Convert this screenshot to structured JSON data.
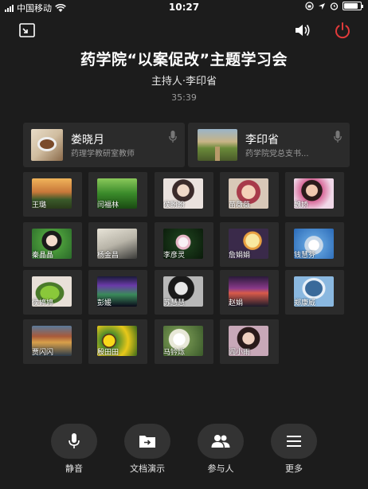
{
  "status_bar": {
    "carrier": "中国移动",
    "time": "10:27",
    "battery_level": 0.85
  },
  "meeting": {
    "title": "药学院“以案促改”主题学习会",
    "host": "主持人·李印省",
    "elapsed": "35:39"
  },
  "speakers": [
    {
      "name": "娄晓月",
      "role": "药理学教研室教师",
      "photo": "food-bowl"
    },
    {
      "name": "李印省",
      "role": "药学院党总支书...",
      "photo": "field-road"
    }
  ],
  "participants": [
    {
      "name": "王璐",
      "photo": "sunset-hill"
    },
    {
      "name": "闫福林",
      "photo": "green-forest"
    },
    {
      "name": "侯盼盼",
      "photo": "portrait-selfie"
    },
    {
      "name": "苗薇薇",
      "photo": "child-portrait"
    },
    {
      "name": "魏娇",
      "photo": "flower-girl"
    },
    {
      "name": "秦晶晶",
      "photo": "woman-garden"
    },
    {
      "name": "杨金昌",
      "photo": "crane-bird"
    },
    {
      "name": "李彦灵",
      "photo": "water-lily"
    },
    {
      "name": "詹娟娟",
      "photo": "moon-cartoon"
    },
    {
      "name": "钱慧芬",
      "photo": "white-ornament"
    },
    {
      "name": "侯婷婷",
      "photo": "green-leaf"
    },
    {
      "name": "彭媛",
      "photo": "night-lights"
    },
    {
      "name": "苏慧慧",
      "photo": "bw-portrait"
    },
    {
      "name": "赵娟",
      "photo": "city-night"
    },
    {
      "name": "郑康威",
      "photo": "parasol-sky"
    },
    {
      "name": "贾闪闪",
      "photo": "autumn-lake"
    },
    {
      "name": "殷田田",
      "photo": "sunflowers"
    },
    {
      "name": "马钤烁",
      "photo": "white-flowers"
    },
    {
      "name": "阎小雨",
      "photo": "girl-portrait"
    }
  ],
  "toolbar": [
    {
      "label": "静音",
      "icon": "microphone-icon"
    },
    {
      "label": "文档演示",
      "icon": "share-document-icon"
    },
    {
      "label": "参与人",
      "icon": "people-icon"
    },
    {
      "label": "更多",
      "icon": "menu-icon"
    }
  ],
  "colors": {
    "background": "#1c1c1c",
    "card": "#2b2b2b",
    "hangup": "#e03a3a",
    "muted_text": "#9a9a9a"
  }
}
